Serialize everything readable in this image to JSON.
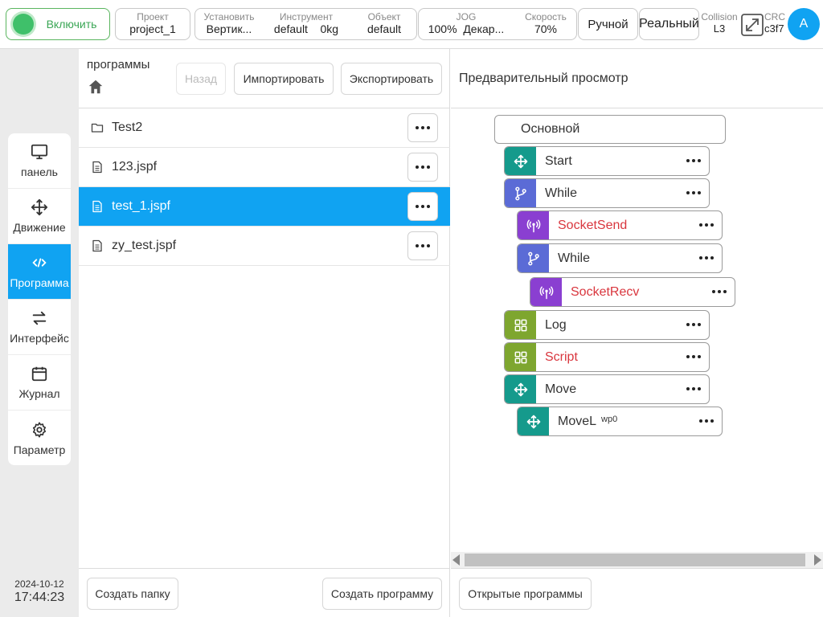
{
  "topbar": {
    "enable_label": "Включить",
    "project": {
      "label": "Проект",
      "value": "project_1"
    },
    "install": {
      "label": "Установить",
      "value": "Вертик..."
    },
    "tool": {
      "label": "Инструмент",
      "value": "default",
      "value2": "0kg"
    },
    "object": {
      "label": "Объект",
      "value": "default"
    },
    "jog": {
      "label": "JOG",
      "value": "100%",
      "value2": "Декар..."
    },
    "speed": {
      "label": "Скорость",
      "value": "70%"
    },
    "mode_manual": "Ручной",
    "mode_real": "Реальный",
    "collision": {
      "label": "Collision",
      "value": "L3"
    },
    "crc": {
      "label": "CRC",
      "value": "c3f7"
    },
    "avatar": "A"
  },
  "nav": {
    "items": [
      {
        "label": "панель",
        "icon": "monitor-icon"
      },
      {
        "label": "Движение",
        "icon": "move-icon"
      },
      {
        "label": "Программа",
        "icon": "code-icon",
        "active": true
      },
      {
        "label": "Интерфейс",
        "icon": "swap-icon"
      },
      {
        "label": "Журнал",
        "icon": "calendar-icon"
      },
      {
        "label": "Параметр",
        "icon": "gear-icon"
      }
    ]
  },
  "datetime": {
    "date": "2024-10-12",
    "time": "17:44:23"
  },
  "programs": {
    "title": "программы",
    "back_label": "Назад",
    "import_label": "Импортировать",
    "export_label": "Экспортировать",
    "files": [
      {
        "name": "Test2",
        "type": "folder"
      },
      {
        "name": "123.jspf",
        "type": "file"
      },
      {
        "name": "test_1.jspf",
        "type": "file",
        "selected": true
      },
      {
        "name": "zy_test.jspf",
        "type": "file"
      }
    ],
    "create_folder_label": "Создать папку",
    "create_program_label": "Создать программу"
  },
  "preview": {
    "title": "Предварительный просмотр",
    "root": "Основной",
    "nodes": [
      {
        "label": "Start",
        "icon": "move-icon",
        "color": "#159a8c"
      },
      {
        "label": "While",
        "icon": "branch-icon",
        "color": "#5b6bd6"
      },
      {
        "label": "SocketSend",
        "icon": "antenna-icon",
        "color": "#8a3fd1",
        "error": true
      },
      {
        "label": "While",
        "icon": "branch-icon",
        "color": "#5b6bd6"
      },
      {
        "label": "SocketRecv",
        "icon": "antenna-icon",
        "color": "#8a3fd1",
        "error": true
      },
      {
        "label": "Log",
        "icon": "grid-icon",
        "color": "#7ea62f"
      },
      {
        "label": "Script",
        "icon": "grid-icon",
        "color": "#7ea62f",
        "error": true
      },
      {
        "label": "Move",
        "icon": "move-icon",
        "color": "#159a8c"
      },
      {
        "label": "MoveL",
        "sub": "wp0",
        "icon": "move-icon",
        "color": "#159a8c"
      }
    ],
    "open_programs_label": "Открытые программы"
  },
  "colors": {
    "accent": "#10a3f2",
    "enable_green": "#3fc06a",
    "error_red": "#d9363e"
  }
}
